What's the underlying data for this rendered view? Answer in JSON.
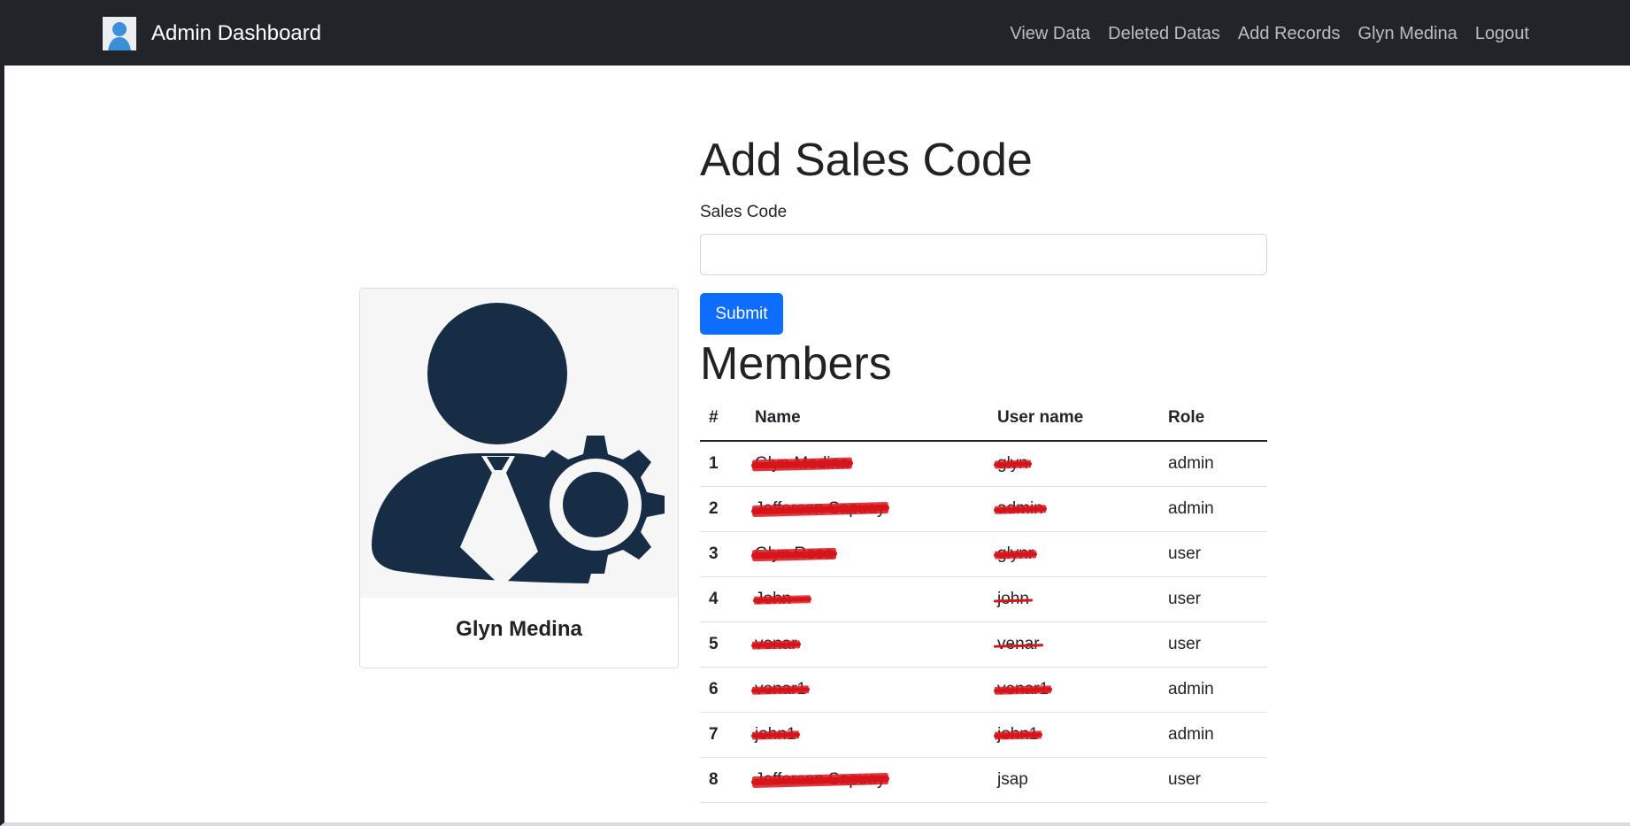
{
  "navbar": {
    "brand_title": "Admin Dashboard",
    "brand_icon": "user-avatar-icon",
    "links": [
      "View Data",
      "Deleted Datas",
      "Add Records",
      "Glyn Medina",
      "Logout"
    ],
    "background_color": "#212529",
    "link_color": "#b8bec5"
  },
  "profile": {
    "name": "Glyn Medina",
    "image_icon": "business-user-gear-icon",
    "image_color": "#172c45"
  },
  "sales_form": {
    "title": "Add Sales Code",
    "label": "Sales Code",
    "input_value": "",
    "submit_label": "Submit",
    "accent_color": "#0d6efd"
  },
  "members": {
    "title": "Members",
    "columns": [
      "#",
      "Name",
      "User name",
      "Role"
    ],
    "rows": [
      {
        "num": "1",
        "name": "Glyn Medina",
        "username": "glyn",
        "role": "admin"
      },
      {
        "num": "2",
        "name": "Jefferson Sapuay",
        "username": "admin",
        "role": "admin"
      },
      {
        "num": "3",
        "name": "Glyn Rosa",
        "username": "glynr",
        "role": "user"
      },
      {
        "num": "4",
        "name": "John",
        "username": "john",
        "role": "user"
      },
      {
        "num": "5",
        "name": "venar",
        "username": "venar",
        "role": "user"
      },
      {
        "num": "6",
        "name": "venar1",
        "username": "venar1",
        "role": "admin"
      },
      {
        "num": "7",
        "name": "john1",
        "username": "john1",
        "role": "admin"
      },
      {
        "num": "8",
        "name": "Jefferson Sapuay",
        "username": "jsap",
        "role": "user"
      }
    ],
    "redaction_color": "#d8141b"
  }
}
